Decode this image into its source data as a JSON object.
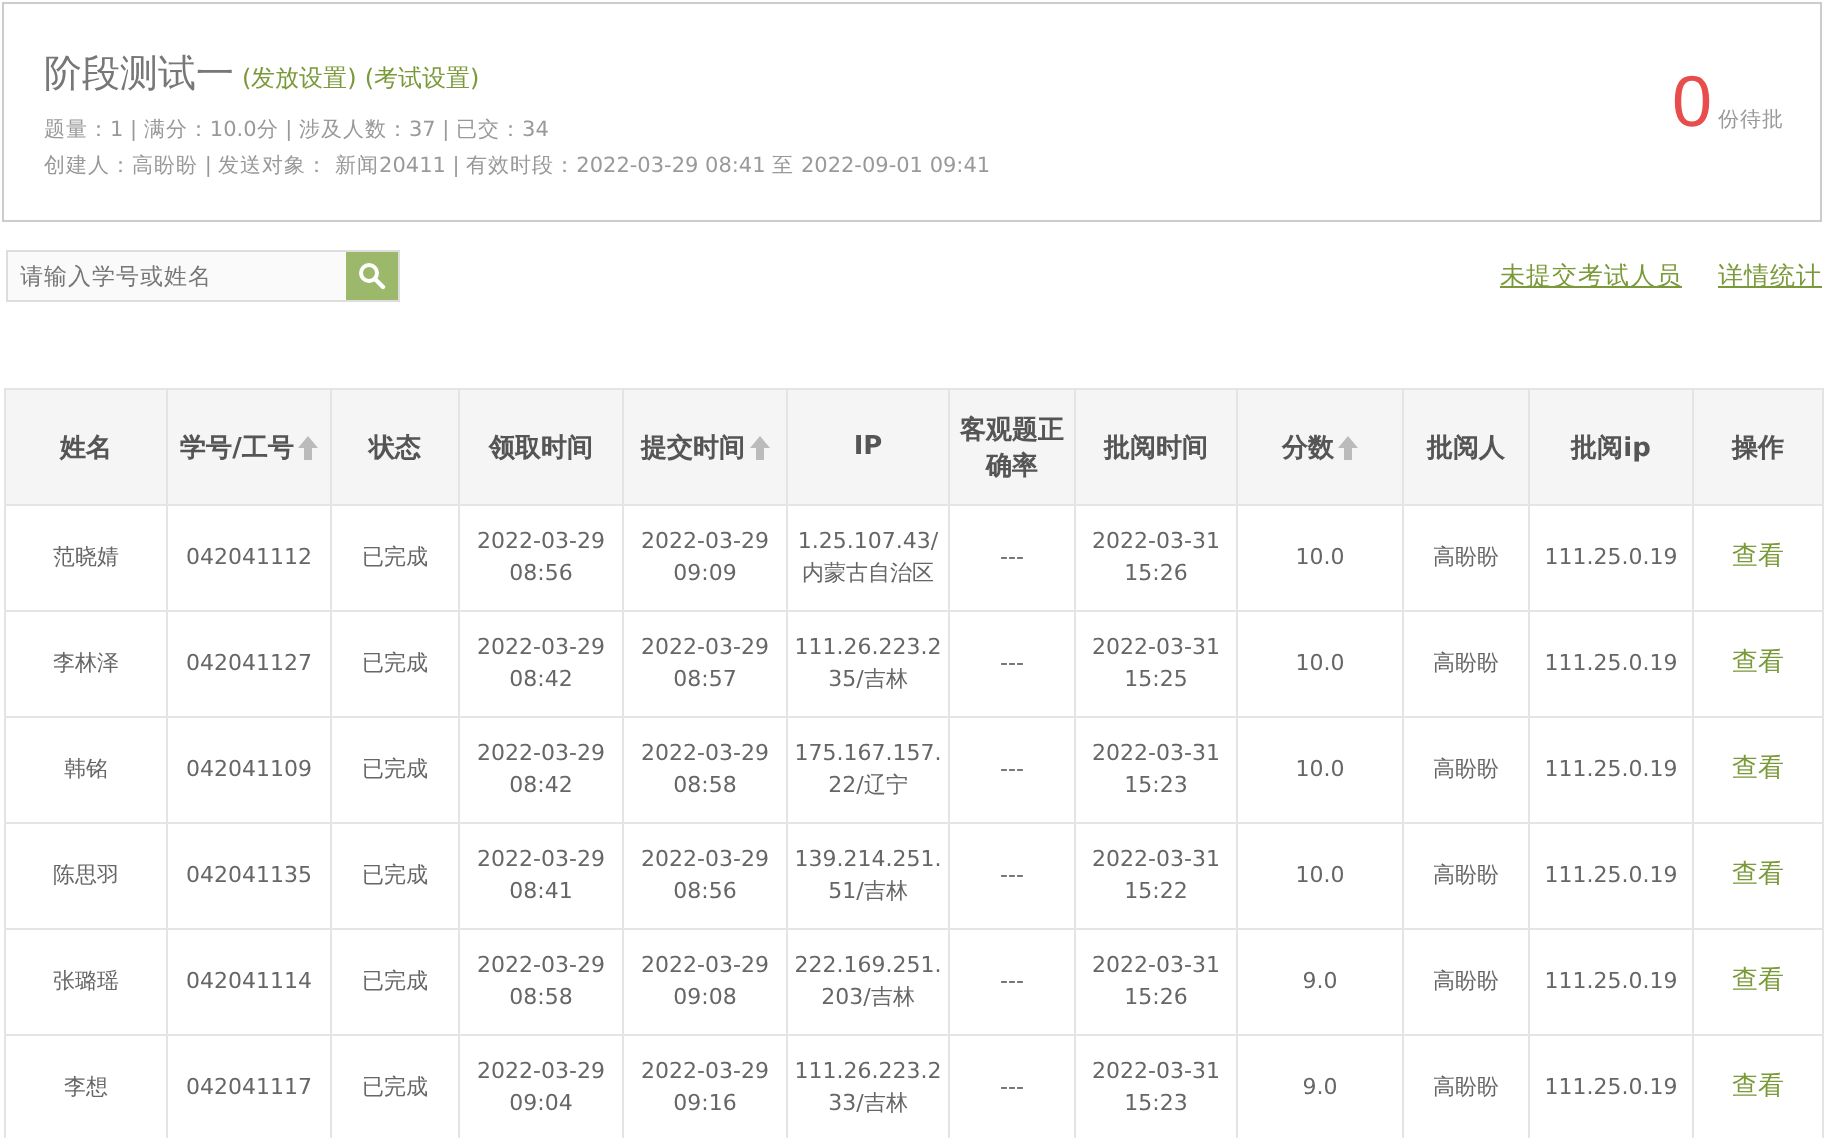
{
  "header": {
    "title": "阶段测试一",
    "links": [
      "(发放设置)",
      "(考试设置)"
    ],
    "stats_line": "题量：1 |  满分：10.0分 |  涉及人数：37 | 已交：34",
    "info_line": "创建人：高盼盼 | 发送对象： 新闻20411  |  有效时段：2022-03-29 08:41 至 2022-09-01 09:41",
    "pending_count": "0",
    "pending_label": "份待批"
  },
  "search": {
    "placeholder": "请输入学号或姓名"
  },
  "actions": [
    "未提交考试人员",
    "详情统计"
  ],
  "table": {
    "columns": [
      {
        "label": "姓名",
        "sortable": false
      },
      {
        "label": "学号/工号",
        "sortable": true
      },
      {
        "label": "状态",
        "sortable": false
      },
      {
        "label": "领取时间",
        "sortable": false
      },
      {
        "label": "提交时间",
        "sortable": true
      },
      {
        "label": "IP",
        "sortable": false
      },
      {
        "label": "客观题正确率",
        "sortable": false
      },
      {
        "label": "批阅时间",
        "sortable": false
      },
      {
        "label": "分数",
        "sortable": true
      },
      {
        "label": "批阅人",
        "sortable": false
      },
      {
        "label": "批阅ip",
        "sortable": false
      },
      {
        "label": "操作",
        "sortable": false
      }
    ],
    "rows": [
      {
        "cells": [
          "范晓婧",
          "042041112",
          "已完成",
          "2022-03-29 08:56",
          "2022-03-29 09:09",
          "1.25.107.43/内蒙古自治区",
          "---",
          "2022-03-31 15:26",
          "10.0",
          "高盼盼",
          "111.25.0.19"
        ],
        "action": "查看"
      },
      {
        "cells": [
          "李林泽",
          "042041127",
          "已完成",
          "2022-03-29 08:42",
          "2022-03-29 08:57",
          "111.26.223.235/吉林",
          "---",
          "2022-03-31 15:25",
          "10.0",
          "高盼盼",
          "111.25.0.19"
        ],
        "action": "查看"
      },
      {
        "cells": [
          "韩铭",
          "042041109",
          "已完成",
          "2022-03-29 08:42",
          "2022-03-29 08:58",
          "175.167.157.22/辽宁",
          "---",
          "2022-03-31 15:23",
          "10.0",
          "高盼盼",
          "111.25.0.19"
        ],
        "action": "查看"
      },
      {
        "cells": [
          "陈思羽",
          "042041135",
          "已完成",
          "2022-03-29 08:41",
          "2022-03-29 08:56",
          "139.214.251.51/吉林",
          "---",
          "2022-03-31 15:22",
          "10.0",
          "高盼盼",
          "111.25.0.19"
        ],
        "action": "查看"
      },
      {
        "cells": [
          "张璐瑶",
          "042041114",
          "已完成",
          "2022-03-29 08:58",
          "2022-03-29 09:08",
          "222.169.251.203/吉林",
          "---",
          "2022-03-31 15:26",
          "9.0",
          "高盼盼",
          "111.25.0.19"
        ],
        "action": "查看"
      },
      {
        "cells": [
          "李想",
          "042041117",
          "已完成",
          "2022-03-29 09:04",
          "2022-03-29 09:16",
          "111.26.223.233/吉林",
          "---",
          "2022-03-31 15:23",
          "9.0",
          "高盼盼",
          "111.25.0.19"
        ],
        "action": "查看"
      }
    ]
  }
}
